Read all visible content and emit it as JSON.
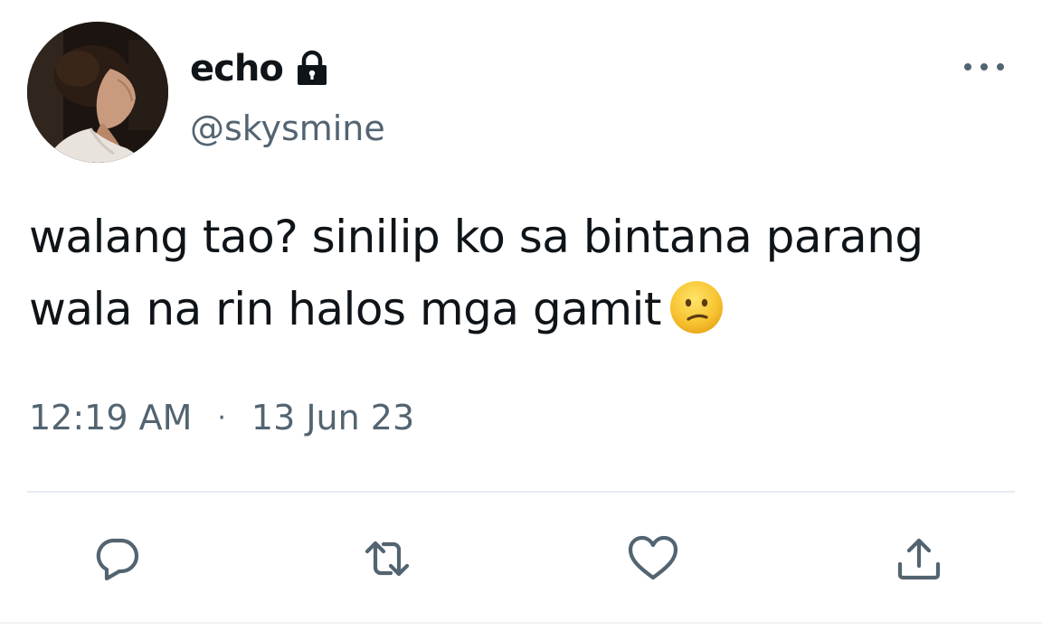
{
  "tweet": {
    "display_name": "echo",
    "handle": "@skysmine",
    "text_lines": [
      "walang tao? sinilip ko sa bintana parang",
      "wala na rin halos mga gamit"
    ],
    "emoji": "confused-face",
    "time": "12:19 AM",
    "separator": "·",
    "date": "13 Jun 23",
    "protected_account_icon": "lock-icon"
  },
  "actions": [
    {
      "name": "reply",
      "icon": "speech-bubble-icon"
    },
    {
      "name": "retweet",
      "icon": "retweet-arrows-icon"
    },
    {
      "name": "like",
      "icon": "heart-icon"
    },
    {
      "name": "share",
      "icon": "share-upload-icon"
    }
  ],
  "colors": {
    "text_primary": "#0f1419",
    "text_secondary": "#536471",
    "icon_gray": "#536471",
    "divider": "#e6ecf0",
    "emoji_yellow": "#f7c331"
  }
}
